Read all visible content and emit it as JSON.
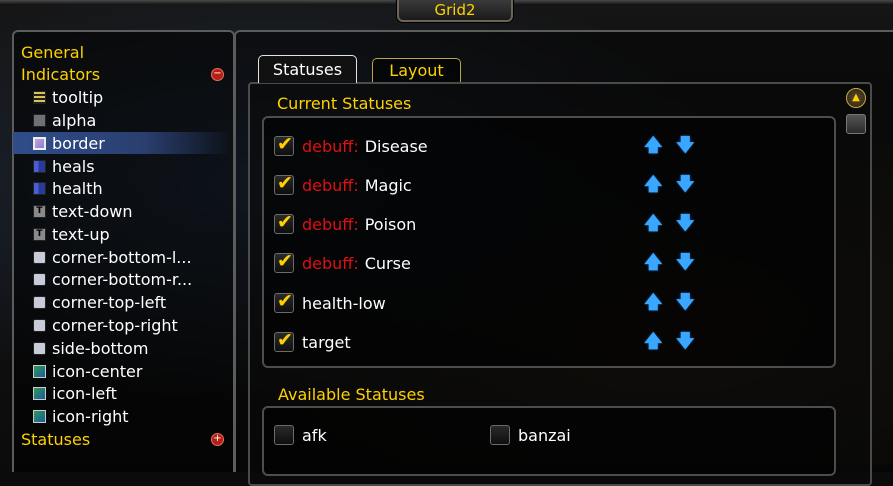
{
  "window": {
    "title": "Grid2"
  },
  "tree": {
    "categories": [
      {
        "label": "General"
      },
      {
        "label": "Indicators",
        "toggle": "−"
      },
      {
        "label": "Statuses",
        "toggle": "+"
      }
    ],
    "items": [
      {
        "label": "tooltip",
        "icon": "list-icon"
      },
      {
        "label": "alpha",
        "icon": "alpha-icon"
      },
      {
        "label": "border",
        "icon": "border-icon",
        "selected": true
      },
      {
        "label": "heals",
        "icon": "bar-icon"
      },
      {
        "label": "health",
        "icon": "bar-icon"
      },
      {
        "label": "text-down",
        "icon": "text-icon"
      },
      {
        "label": "text-up",
        "icon": "text-icon"
      },
      {
        "label": "corner-bottom-l...",
        "icon": "square-icon"
      },
      {
        "label": "corner-bottom-r...",
        "icon": "square-icon"
      },
      {
        "label": "corner-top-left",
        "icon": "square-icon"
      },
      {
        "label": "corner-top-right",
        "icon": "square-icon"
      },
      {
        "label": "side-bottom",
        "icon": "square-icon"
      },
      {
        "label": "icon-center",
        "icon": "image-icon"
      },
      {
        "label": "icon-left",
        "icon": "image-icon"
      },
      {
        "label": "icon-right",
        "icon": "image-icon"
      }
    ]
  },
  "tabs": [
    {
      "label": "Statuses",
      "active": true
    },
    {
      "label": "Layout",
      "active": false
    }
  ],
  "current": {
    "title": "Current Statuses",
    "rows": [
      {
        "prefix": "debuff:",
        "name": "Disease",
        "checked": true
      },
      {
        "prefix": "debuff:",
        "name": "Magic",
        "checked": true
      },
      {
        "prefix": "debuff:",
        "name": "Poison",
        "checked": true
      },
      {
        "prefix": "debuff:",
        "name": "Curse",
        "checked": true
      },
      {
        "prefix": "",
        "name": "health-low",
        "checked": true
      },
      {
        "prefix": "",
        "name": "target",
        "checked": true
      }
    ]
  },
  "available": {
    "title": "Available Statuses",
    "items": [
      {
        "name": "afk",
        "checked": false
      },
      {
        "name": "banzai",
        "checked": false
      }
    ]
  },
  "colors": {
    "gold": "#ffd100",
    "debuff_red": "#e01010",
    "arrow_blue": "#39a6ff",
    "selection": "#2f4d8a"
  }
}
